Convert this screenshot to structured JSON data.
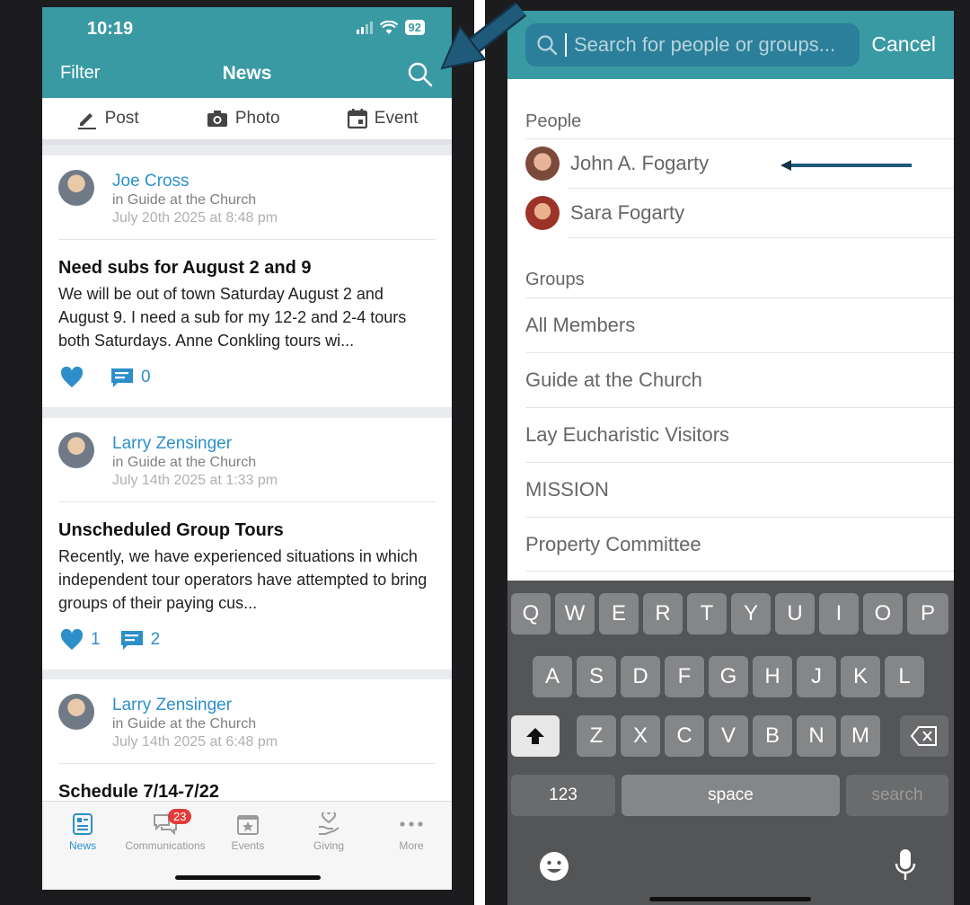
{
  "left": {
    "status": {
      "time": "10:19",
      "battery": "92"
    },
    "header": {
      "filter": "Filter",
      "title": "News"
    },
    "post_bar": {
      "post": "Post",
      "photo": "Photo",
      "event": "Event"
    },
    "posts": [
      {
        "author": "Joe Cross",
        "group": "in Guide at the Church",
        "date": "July 20th 2025 at 8:48 pm",
        "title": "Need subs for August 2 and 9",
        "body": "We will be out of town Saturday August 2 and August 9. I need a sub for my 12-2 and 2-4 tours both Saturdays. Anne Conkling tours wi...",
        "likes": "",
        "comments": "0"
      },
      {
        "author": "Larry Zensinger",
        "group": "in Guide at the Church",
        "date": "July 14th 2025 at 1:33 pm",
        "title": "Unscheduled Group Tours",
        "body": "Recently, we have experienced situations in which independent tour operators have attempted to bring groups of their paying cus...",
        "likes": "1",
        "comments": "2"
      },
      {
        "author": "Larry Zensinger",
        "group": "in Guide at the Church",
        "date": "July 14th 2025 at 6:48 pm",
        "title": "Schedule 7/14-7/22"
      }
    ],
    "tabs": [
      {
        "label": "News",
        "icon": "news-icon"
      },
      {
        "label": "Communications",
        "icon": "chat-icon",
        "badge": "23"
      },
      {
        "label": "Events",
        "icon": "calendar-star-icon"
      },
      {
        "label": "Giving",
        "icon": "giving-icon"
      },
      {
        "label": "More",
        "icon": "more-icon"
      }
    ]
  },
  "right": {
    "search": {
      "placeholder": "Search for people or groups...",
      "cancel": "Cancel"
    },
    "people_label": "People",
    "people": [
      "John A. Fogarty",
      "Sara Fogarty"
    ],
    "groups_label": "Groups",
    "groups": [
      "All Members",
      "Guide at the Church",
      "Lay Eucharistic Visitors",
      "MISSION",
      "Property Committee"
    ],
    "keyboard": {
      "row1": [
        "Q",
        "W",
        "E",
        "R",
        "T",
        "Y",
        "U",
        "I",
        "O",
        "P"
      ],
      "row2": [
        "A",
        "S",
        "D",
        "F",
        "G",
        "H",
        "J",
        "K",
        "L"
      ],
      "row3": [
        "Z",
        "X",
        "C",
        "V",
        "B",
        "N",
        "M"
      ],
      "numbers": "123",
      "space": "space",
      "search": "search"
    }
  },
  "colors": {
    "accent": "#3a9aa4",
    "link": "#2d8fc9",
    "badge": "#e23b3b",
    "annotation_arrow": "#1f5a7a"
  }
}
